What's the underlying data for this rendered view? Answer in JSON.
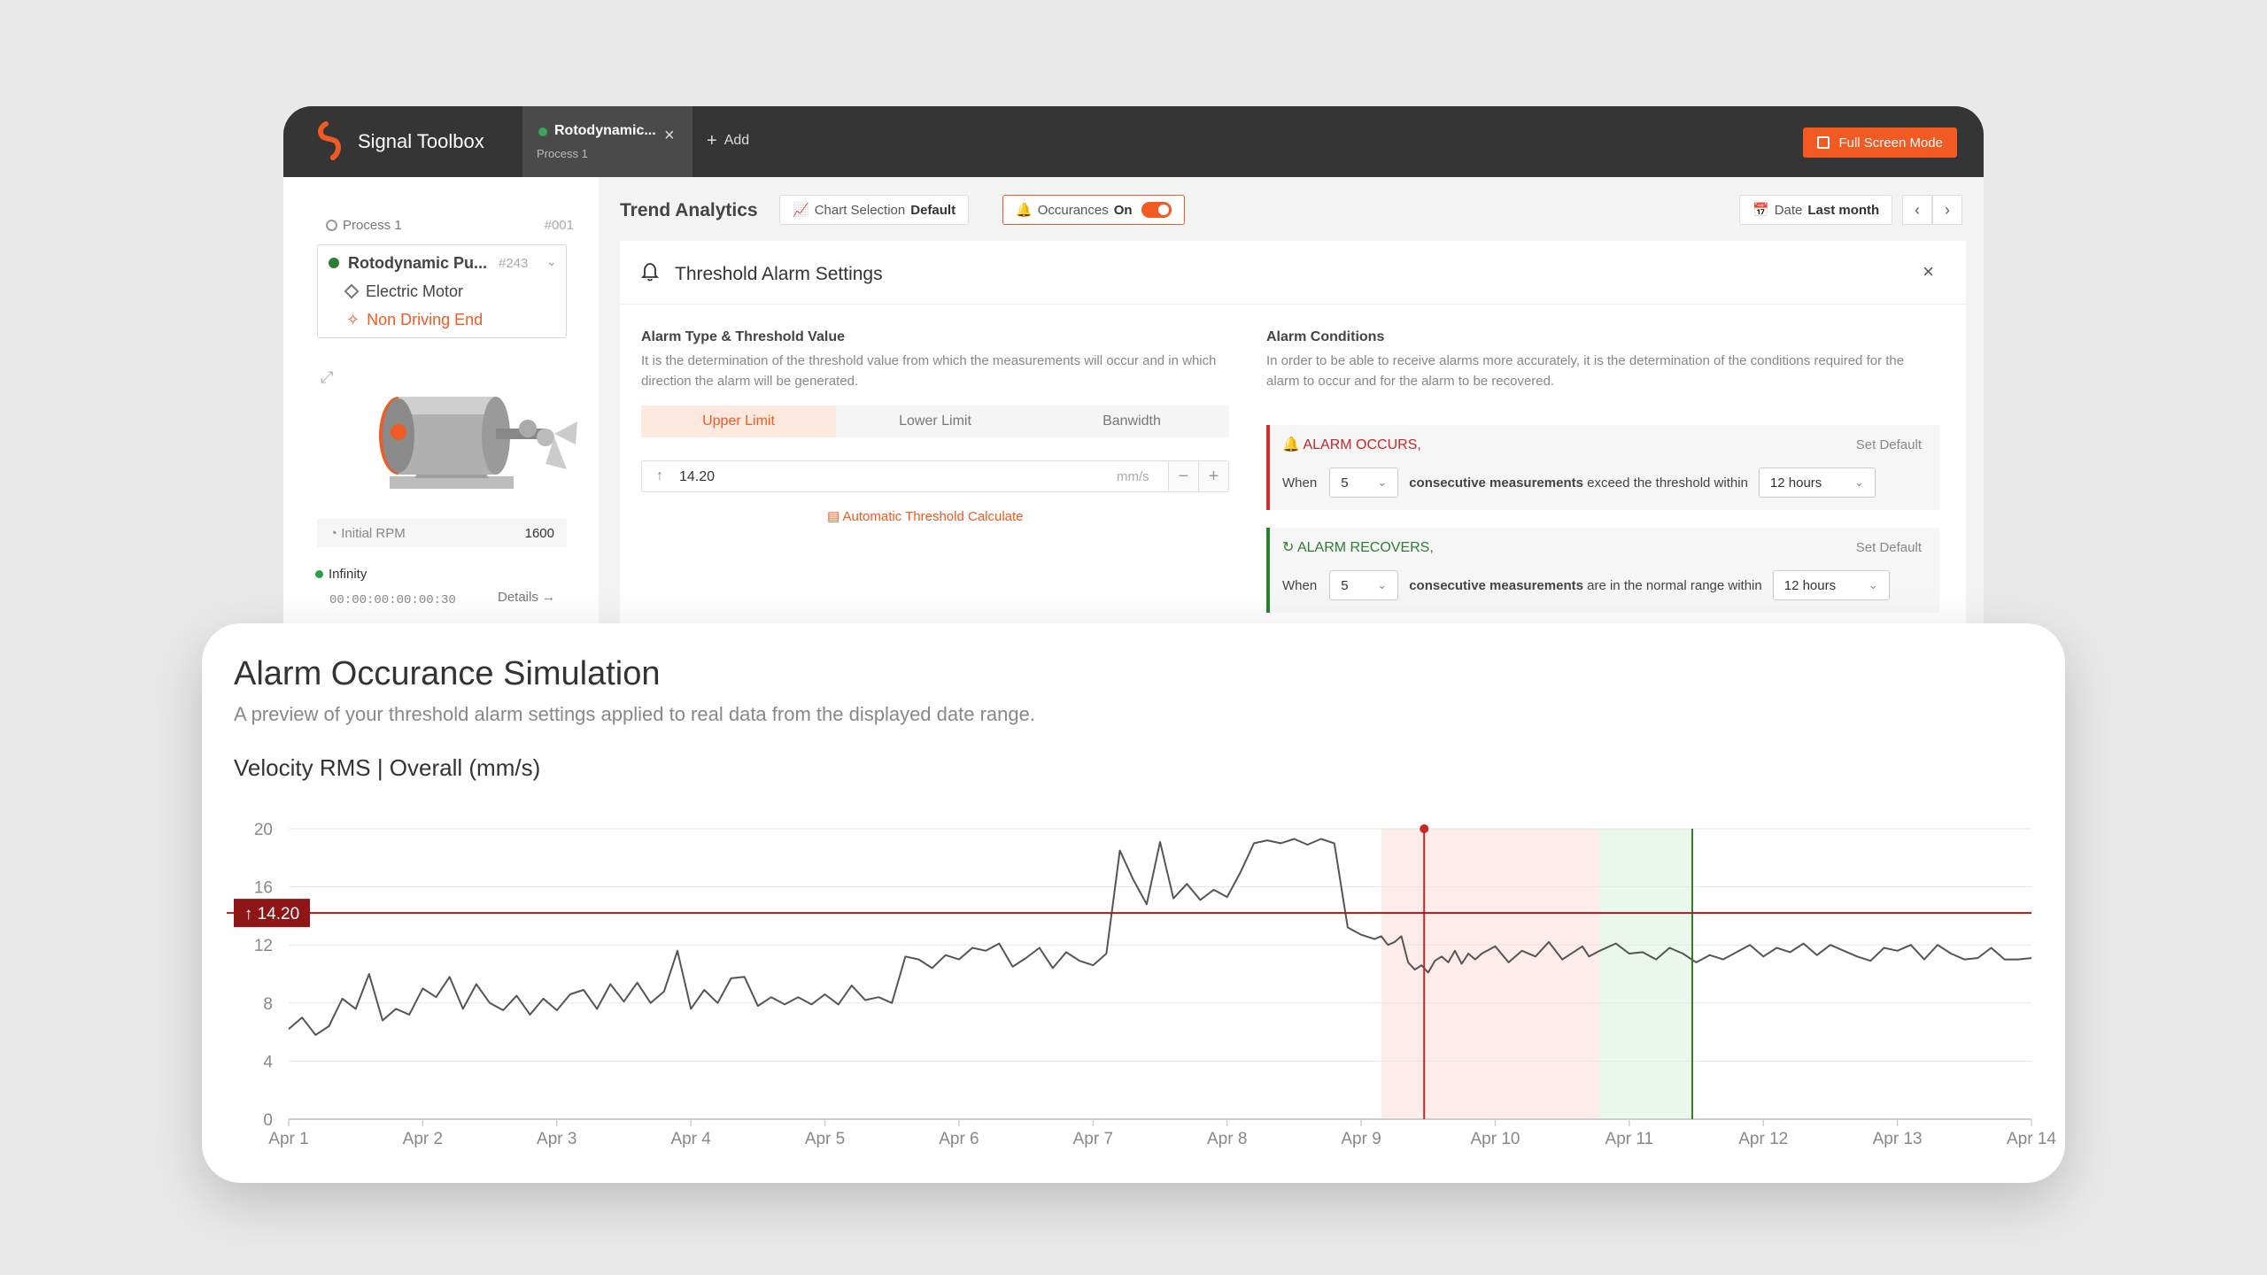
{
  "app": {
    "title": "Signal Toolbox",
    "tab_name": "Rotodynamic...",
    "tab_sub": "Process 1",
    "add_label": "Add",
    "fullscreen_label": "Full Screen Mode",
    "brand_color": "#f15a22"
  },
  "sidebar": {
    "process_label": "Process 1",
    "process_num": "#001",
    "asset_name": "Rotodynamic Pu...",
    "asset_num": "#243",
    "component": "Electric Motor",
    "location": "Non Driving End",
    "rpm_label": "Initial RPM",
    "rpm_value": "1600",
    "status_label": "Infinity",
    "runtime": "00:00:00:00:00:30",
    "details_label": "Details"
  },
  "toolbar": {
    "title": "Trend Analytics",
    "chart_selection_label": "Chart Selection",
    "chart_selection_value": "Default",
    "occurances_label": "Occurances",
    "occurances_value": "On",
    "date_label": "Date",
    "date_value": "Last month"
  },
  "panel": {
    "title": "Threshold Alarm Settings",
    "left_title": "Alarm Type & Threshold Value",
    "left_desc": "It is the determination of the threshold value from which the measurements will occur and in which direction the alarm will be generated.",
    "tabs": [
      "Upper Limit",
      "Lower Limit",
      "Banwidth"
    ],
    "threshold_value": "14.20",
    "unit": "mm/s",
    "auto_calc": "Automatic Threshold Calculate",
    "right_title": "Alarm Conditions",
    "right_desc": "In order to be able to receive alarms more accurately, it is the determination of the conditions required for the alarm to occur and for the alarm to be recovered.",
    "occurs": {
      "label": "ALARM OCCURS,",
      "set_default": "Set Default",
      "when": "When",
      "count": "5",
      "text_a": "consecutive measurements",
      "text_b": "exceed the threshold within",
      "window": "12 hours"
    },
    "recovers": {
      "label": "ALARM RECOVERS,",
      "set_default": "Set Default",
      "when": "When",
      "count": "5",
      "text_a": "consecutive measurements",
      "text_b": "are in the normal range within",
      "window": "12 hours"
    }
  },
  "simulation": {
    "title": "Alarm Occurance Simulation",
    "subtitle": "A preview of your threshold alarm settings applied to real data from the displayed date range.",
    "chart_title": "Velocity RMS | Overall (mm/s)",
    "threshold_label": "14.20"
  },
  "chart_data": {
    "type": "line",
    "title": "Velocity RMS | Overall (mm/s)",
    "xlabel": "",
    "ylabel": "",
    "ylim": [
      0,
      20
    ],
    "yticks": [
      0,
      4,
      8,
      12,
      16,
      20
    ],
    "xticks": [
      "Apr 1",
      "Apr 2",
      "Apr 3",
      "Apr 4",
      "Apr 5",
      "Apr 6",
      "Apr 7",
      "Apr 8",
      "Apr 9",
      "Apr 10",
      "Apr 11",
      "Apr 12",
      "Apr 13",
      "Apr 14"
    ],
    "threshold": 14.2,
    "alarm_region": [
      9.15,
      10.78
    ],
    "recovery_region": [
      10.78,
      11.47
    ],
    "alarm_marker_x": 9.47,
    "recovery_marker_x": 11.47,
    "colors": {
      "line": "#555555",
      "threshold": "#a31c1c",
      "alarm_fill": "#fdecea",
      "recovery_fill": "#eaf8ec",
      "recovery_line": "#2e7d32",
      "marker": "#c62828"
    },
    "series": [
      {
        "x": [
          1.0,
          1.1,
          1.2,
          1.3,
          1.4,
          1.5,
          1.6,
          1.7,
          1.8,
          1.9,
          2.0,
          2.1,
          2.2,
          2.3,
          2.4,
          2.5,
          2.6,
          2.7,
          2.8,
          2.9,
          3.0,
          3.1,
          3.2,
          3.3,
          3.4,
          3.5,
          3.6,
          3.7,
          3.8,
          3.9,
          4.0,
          4.1,
          4.2,
          4.3,
          4.4,
          4.5,
          4.6,
          4.7,
          4.8,
          4.9,
          5.0,
          5.1,
          5.2,
          5.3,
          5.4,
          5.5,
          5.6,
          5.7,
          5.8,
          5.9,
          6.0,
          6.1,
          6.2,
          6.3,
          6.4,
          6.5,
          6.6,
          6.7,
          6.8,
          6.9,
          7.0,
          7.1,
          7.2,
          7.3,
          7.4,
          7.5,
          7.6,
          7.7,
          7.8,
          7.9,
          8.0,
          8.1,
          8.2,
          8.3,
          8.4,
          8.5,
          8.6,
          8.7,
          8.8,
          8.9,
          9.0,
          9.1,
          9.15,
          9.2,
          9.25,
          9.3,
          9.35,
          9.4,
          9.45,
          9.5,
          9.55,
          9.6,
          9.65,
          9.7,
          9.75,
          9.8,
          9.85,
          9.9,
          10.0,
          10.1,
          10.2,
          10.3,
          10.4,
          10.5,
          10.6,
          10.65,
          10.7,
          10.78,
          10.9,
          11.0,
          11.1,
          11.2,
          11.3,
          11.4,
          11.5,
          11.6,
          11.7,
          11.8,
          11.9,
          12.0,
          12.1,
          12.2,
          12.3,
          12.4,
          12.5,
          12.6,
          12.7,
          12.8,
          12.9,
          13.0,
          13.1,
          13.2,
          13.3,
          13.4,
          13.5,
          13.6,
          13.7,
          13.8,
          13.9,
          14.0
        ],
        "values": [
          6.2,
          7.0,
          5.8,
          6.4,
          8.3,
          7.6,
          10.0,
          6.8,
          7.6,
          7.2,
          9.0,
          8.4,
          9.8,
          7.6,
          9.3,
          8.0,
          7.5,
          8.5,
          7.2,
          8.3,
          7.5,
          8.6,
          8.9,
          7.6,
          9.3,
          8.1,
          9.4,
          8.0,
          8.8,
          11.6,
          7.6,
          8.9,
          8.0,
          9.7,
          9.8,
          7.8,
          8.4,
          7.9,
          8.4,
          7.9,
          8.6,
          7.9,
          9.2,
          8.2,
          8.4,
          8.0,
          11.2,
          11.0,
          10.4,
          11.3,
          11.0,
          11.8,
          11.6,
          12.1,
          10.5,
          11.1,
          11.8,
          10.4,
          11.5,
          10.9,
          10.6,
          11.4,
          18.5,
          16.5,
          14.8,
          19.1,
          15.2,
          16.2,
          15.1,
          15.8,
          15.3,
          17.0,
          19.0,
          19.2,
          19.0,
          19.3,
          18.9,
          19.3,
          19.0,
          13.2,
          12.7,
          12.4,
          12.6,
          12.0,
          12.2,
          12.6,
          10.8,
          10.3,
          10.6,
          10.1,
          10.9,
          11.2,
          10.8,
          11.6,
          10.7,
          11.4,
          11.0,
          11.4,
          11.9,
          10.8,
          11.6,
          11.2,
          12.2,
          11.0,
          11.6,
          11.9,
          11.2,
          11.6,
          12.1,
          11.4,
          11.5,
          11.0,
          11.8,
          11.4,
          10.8,
          11.3,
          11.0,
          11.5,
          12.0,
          11.2,
          11.8,
          11.5,
          12.1,
          11.3,
          12.0,
          11.6,
          11.2,
          10.9,
          11.8,
          11.6,
          12.0,
          11.0,
          12.0,
          11.4,
          11.0,
          11.1,
          11.8,
          11.0,
          11.0,
          11.1
        ]
      }
    ]
  }
}
